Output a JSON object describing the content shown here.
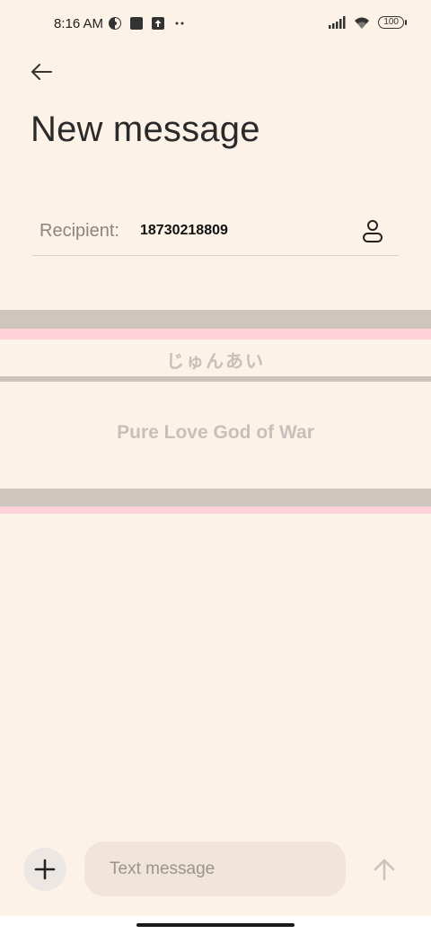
{
  "status_bar": {
    "time": "8:16 AM",
    "battery": "100",
    "left_icons": [
      "circle-half-icon",
      "square-app-icon",
      "upload-icon",
      "more-dots-icon"
    ],
    "right_icons": [
      "signal-icon",
      "wifi-icon",
      "battery-icon"
    ]
  },
  "header": {
    "back_icon": "arrow-left-icon",
    "title": "New message"
  },
  "recipient": {
    "label": "Recipient:",
    "value": "18730218809",
    "contact_icon": "person-icon"
  },
  "banner": {
    "japanese_text": "じゅんあい",
    "english_text": "Pure Love God of War",
    "colors": {
      "gray": "#cfc5bf",
      "pink": "#ffd1d8",
      "text": "#c8bfbb"
    }
  },
  "composer": {
    "attach_icon": "plus-icon",
    "placeholder": "Text message",
    "send_icon": "arrow-up-icon"
  },
  "colors": {
    "background": "#fdf2e8",
    "input_background": "#f1e4d8"
  }
}
